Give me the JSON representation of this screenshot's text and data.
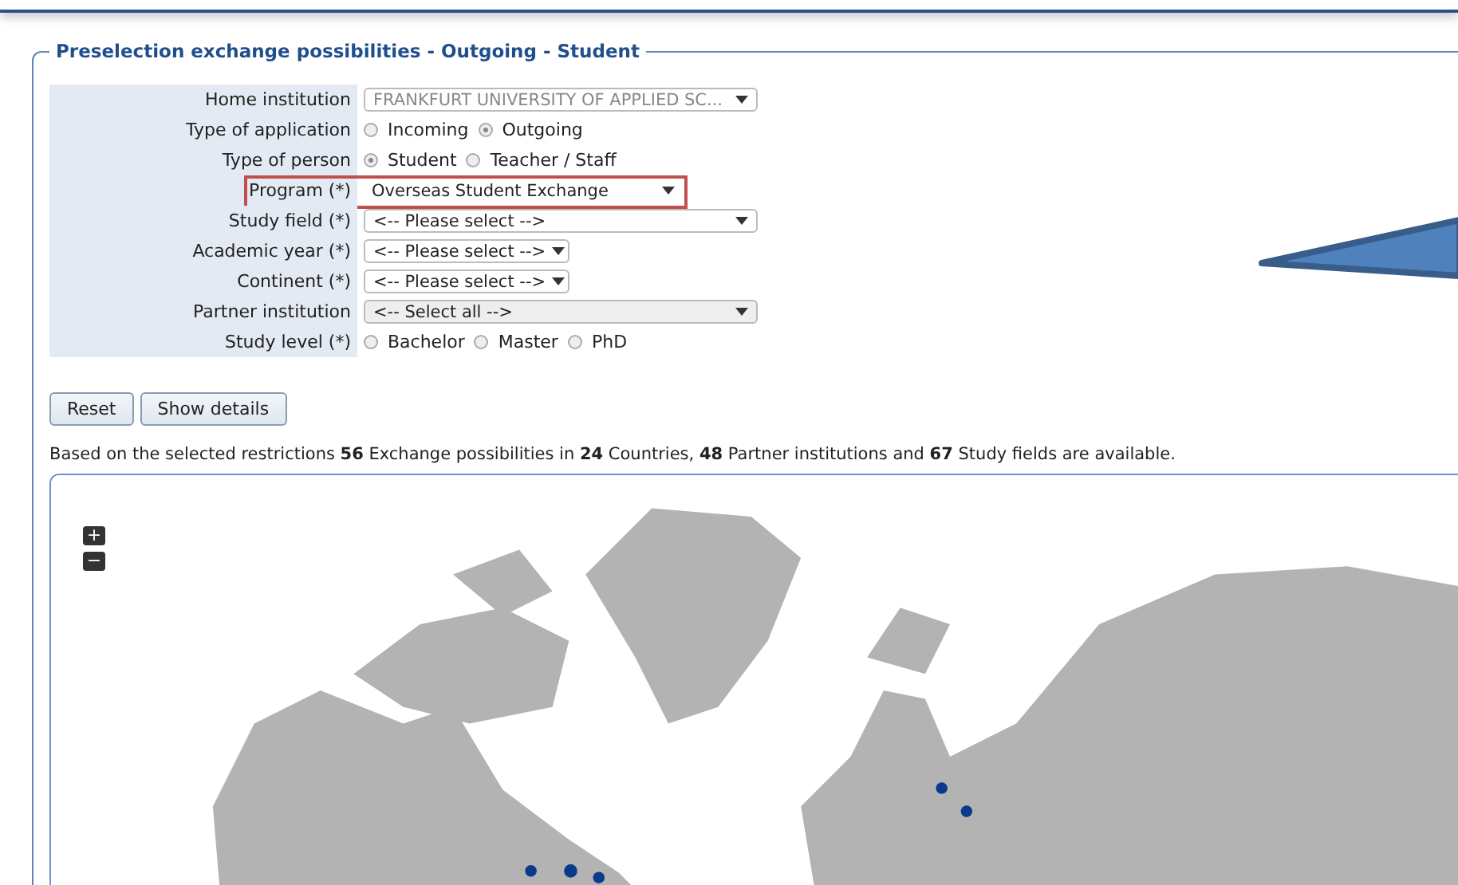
{
  "fieldset": {
    "legend": "Preselection exchange possibilities - Outgoing - Student"
  },
  "form": {
    "rows": [
      {
        "label": "Home institution",
        "kind": "select_wide",
        "value": "FRANKFURT UNIVERSITY OF APPLIED SC...",
        "disabled": true,
        "readonly": false,
        "highlighted": false
      },
      {
        "label": "Type of application",
        "kind": "radio",
        "options": [
          {
            "label": "Incoming",
            "selected": false
          },
          {
            "label": "Outgoing",
            "selected": true
          }
        ],
        "highlighted": false
      },
      {
        "label": "Type of person",
        "kind": "radio",
        "options": [
          {
            "label": "Student",
            "selected": true
          },
          {
            "label": "Teacher / Staff",
            "selected": false
          }
        ],
        "highlighted": false
      },
      {
        "label": "Program (*)",
        "kind": "select_medium",
        "value": "Overseas Student Exchange",
        "disabled": false,
        "readonly": false,
        "highlighted": true
      },
      {
        "label": "Study field (*)",
        "kind": "select_wide",
        "value": "<-- Please select -->",
        "disabled": false,
        "readonly": false,
        "highlighted": false
      },
      {
        "label": "Academic year (*)",
        "kind": "select_short",
        "value": "<-- Please select -->",
        "disabled": false,
        "readonly": false,
        "highlighted": false
      },
      {
        "label": "Continent (*)",
        "kind": "select_short",
        "value": "<-- Please select -->",
        "disabled": false,
        "readonly": false,
        "highlighted": false
      },
      {
        "label": "Partner institution",
        "kind": "select_wide",
        "value": "<-- Select all -->",
        "disabled": false,
        "readonly": true,
        "highlighted": false
      },
      {
        "label": "Study level (*)",
        "kind": "radio",
        "options": [
          {
            "label": "Bachelor",
            "selected": false
          },
          {
            "label": "Master",
            "selected": false
          },
          {
            "label": "PhD",
            "selected": false
          }
        ],
        "highlighted": false
      }
    ]
  },
  "buttons": [
    "Reset",
    "Show details"
  ],
  "summary": "Based on the selected restrictions **56** Exchange possibilities in **24** Countries, **48** Partner institutions and **67** Study fields are available.",
  "map": {
    "zoom_in": "+",
    "zoom_out": "−"
  }
}
